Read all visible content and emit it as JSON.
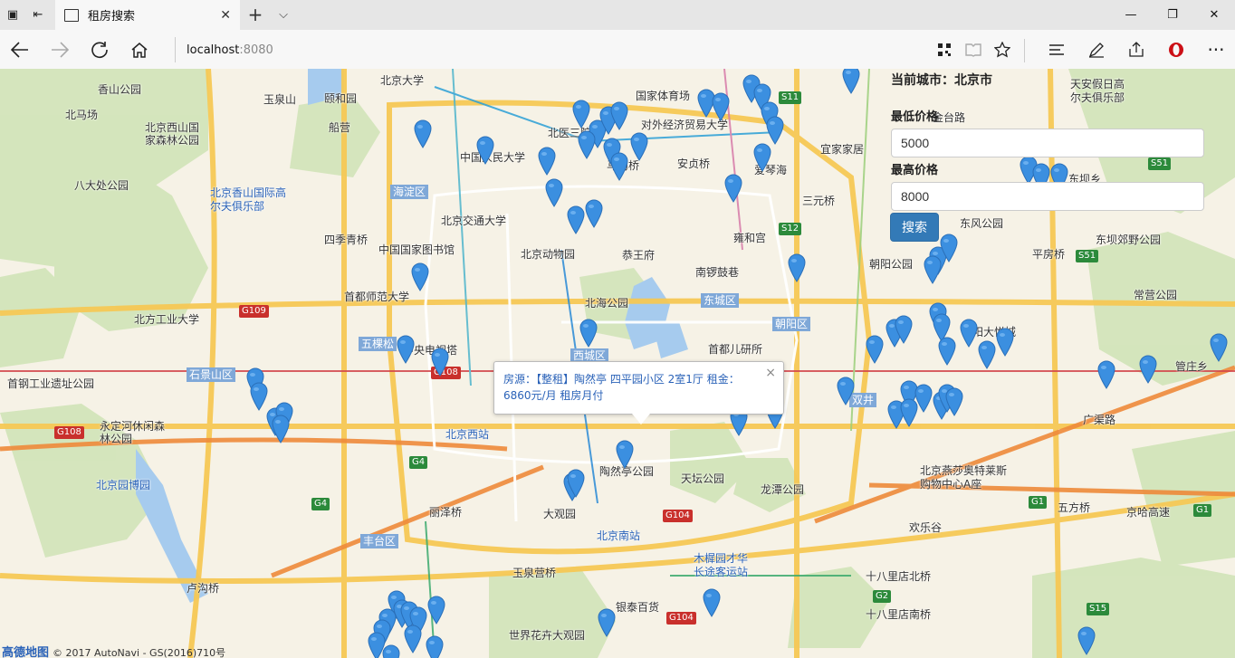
{
  "browser": {
    "tab_title": "租房搜索",
    "tab_close": "✕",
    "new_tab": "+",
    "tab_menu": "⌵",
    "address_host": "localhost",
    "address_port": ":8080",
    "window_min": "—",
    "window_restore": "❐",
    "window_close": "✕"
  },
  "search_panel": {
    "current_city_label": "当前城市：",
    "current_city": "北京市",
    "min_price_label": "最低价格",
    "min_price_value": "5000",
    "max_price_label": "最高价格",
    "max_price_value": "8000",
    "search_button": "搜索"
  },
  "popup": {
    "text": "房源：【整租】陶然亭 四平园小区 2室1厅 租金：6860元/月 租房月付",
    "close": "×"
  },
  "attribution": {
    "logo": "高德地图",
    "text": "© 2017 AutoNavi - GS(2016)710号"
  },
  "map_labels": [
    {
      "text": "香山公园"
    },
    {
      "text": "颐和园"
    },
    {
      "text": "北京大学"
    },
    {
      "text": "玉泉山"
    },
    {
      "text": "船营"
    },
    {
      "text": "北马场"
    },
    {
      "text": "北京西山国家森林公园"
    },
    {
      "text": "八大处公园"
    },
    {
      "text": "北京香山国际高尔夫俱乐部"
    },
    {
      "text": "海淀区"
    },
    {
      "text": "中国人民大学"
    },
    {
      "text": "北京交通大学"
    },
    {
      "text": "中国国家图书馆"
    },
    {
      "text": "北京动物园"
    },
    {
      "text": "四季青桥"
    },
    {
      "text": "首都师范大学"
    },
    {
      "text": "北方工业大学"
    },
    {
      "text": "石景山区"
    },
    {
      "text": "五棵松"
    },
    {
      "text": "中央电视塔"
    },
    {
      "text": "首钢工业遗址公园"
    },
    {
      "text": "永定河休闲森林公园"
    },
    {
      "text": "北京西站"
    },
    {
      "text": "北京园博园"
    },
    {
      "text": "丽泽桥"
    },
    {
      "text": "丰台区"
    },
    {
      "text": "卢沟桥"
    },
    {
      "text": "国家体育场"
    },
    {
      "text": "北医三院"
    },
    {
      "text": "对外经济贸易大学"
    },
    {
      "text": "马甸桥"
    },
    {
      "text": "安贞桥"
    },
    {
      "text": "爱琴海"
    },
    {
      "text": "宜家家居"
    },
    {
      "text": "三元桥"
    },
    {
      "text": "雍和宫"
    },
    {
      "text": "恭王府"
    },
    {
      "text": "南锣鼓巷"
    },
    {
      "text": "东城区"
    },
    {
      "text": "北海公园"
    },
    {
      "text": "西城区"
    },
    {
      "text": "首都儿研所"
    },
    {
      "text": "朝阳区"
    },
    {
      "text": "朝阳公园"
    },
    {
      "text": "东风公园"
    },
    {
      "text": "平房桥"
    },
    {
      "text": "东坝郊野公园"
    },
    {
      "text": "常营公园"
    },
    {
      "text": "朝阳大悦城"
    },
    {
      "text": "管庄乡"
    },
    {
      "text": "天坛公园"
    },
    {
      "text": "陶然亭公园"
    },
    {
      "text": "龙潭公园"
    },
    {
      "text": "大观园"
    },
    {
      "text": "北京南站"
    },
    {
      "text": "木樨园才华长途客运站"
    },
    {
      "text": "玉泉营桥"
    },
    {
      "text": "银泰百货"
    },
    {
      "text": "世界花卉大观园"
    },
    {
      "text": "十八里店北桥"
    },
    {
      "text": "十八里店南桥"
    },
    {
      "text": "北京燕莎奥特莱斯购物中心A座"
    },
    {
      "text": "欢乐谷"
    },
    {
      "text": "五方桥"
    },
    {
      "text": "京哈高速"
    },
    {
      "text": "双井"
    },
    {
      "text": "广渠路"
    },
    {
      "text": "天安假日高尔夫俱乐部"
    },
    {
      "text": "金台路"
    },
    {
      "text": "东坝乡"
    }
  ]
}
